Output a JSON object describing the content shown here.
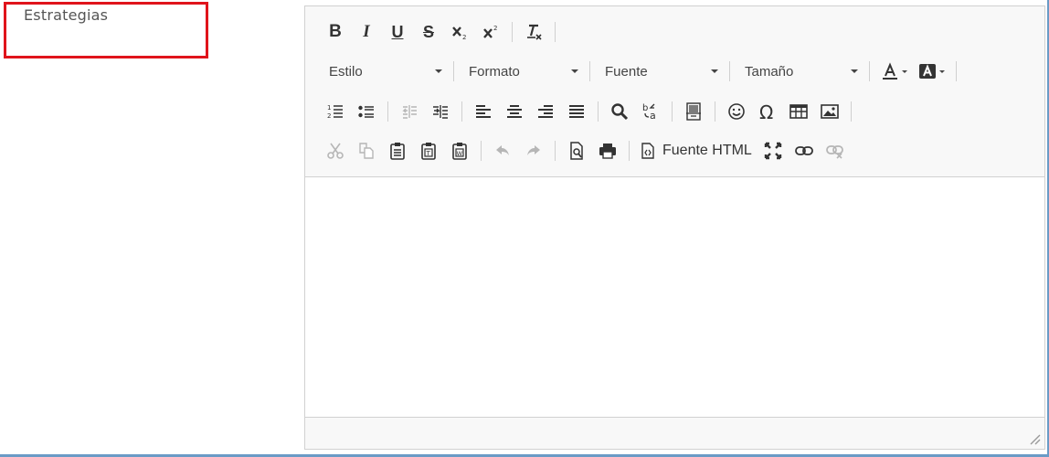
{
  "field": {
    "label": "Estrategias"
  },
  "toolbar": {
    "styles_combo": "Estilo",
    "format_combo": "Formato",
    "font_combo": "Fuente",
    "size_combo": "Tamaño",
    "source_label": "Fuente HTML",
    "icons": {
      "bold": "bold-icon",
      "italic": "italic-icon",
      "underline": "underline-icon",
      "strike": "strikethrough-icon",
      "subscript": "subscript-icon",
      "superscript": "superscript-icon",
      "remove_format": "remove-format-icon"
    }
  },
  "colors": {
    "accent_frame": "#6a9bc6",
    "highlight": "#e0141b",
    "toolbar_bg": "#f8f8f8"
  }
}
